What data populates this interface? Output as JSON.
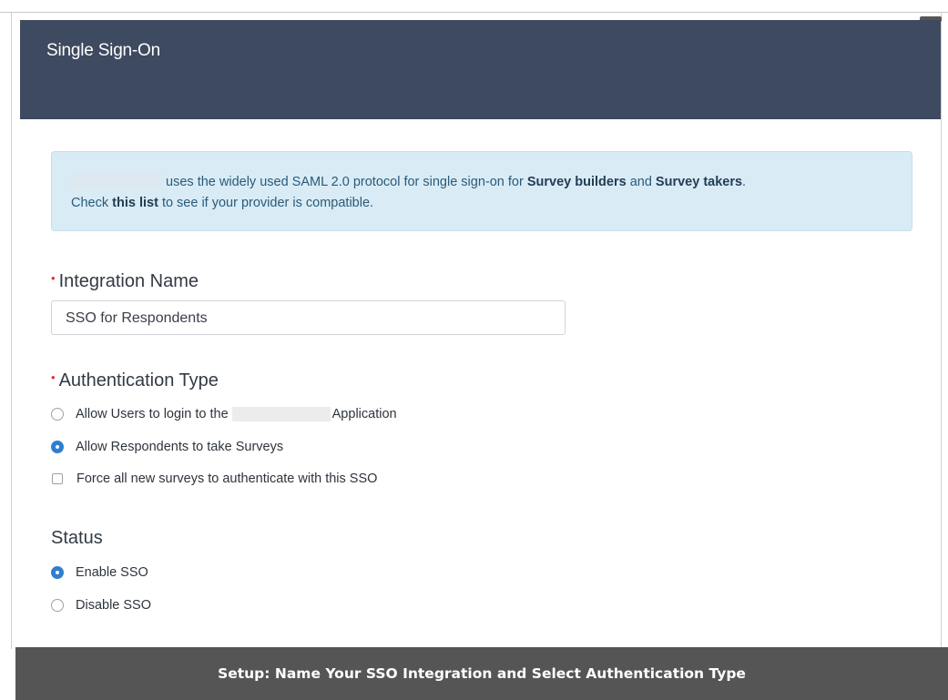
{
  "header": {
    "title": "Single Sign-On"
  },
  "info": {
    "line1_text": "uses the widely used SAML 2.0 protocol for single sign-on for",
    "survey_builders": "Survey builders",
    "and": "and",
    "survey_takers": "Survey takers",
    "period": ".",
    "check": "Check",
    "this_list": "this list",
    "line2_rest": "to see if your provider is compatible."
  },
  "integration": {
    "required_mark": "•",
    "label": "Integration Name",
    "value": "SSO for Respondents"
  },
  "auth": {
    "required_mark": "•",
    "label": "Authentication Type",
    "option_users_prefix": "Allow Users to login to the",
    "option_users_suffix": "Application",
    "option_respondents": "Allow Respondents to take Surveys",
    "force_checkbox": "Force all new surveys to authenticate with this SSO",
    "selected": "Allow Respondents to take Surveys",
    "force_checked": false
  },
  "status": {
    "label": "Status",
    "enable": "Enable SSO",
    "disable": "Disable SSO",
    "selected": "Enable SSO"
  },
  "caption": "Setup: Name Your SSO Integration and Select Authentication Type",
  "colors": {
    "header_bg": "#3e4a5f",
    "info_bg": "#d9ecf5",
    "accent": "#2f7fd1",
    "required": "#e0312e",
    "caption_bg": "#555555"
  }
}
